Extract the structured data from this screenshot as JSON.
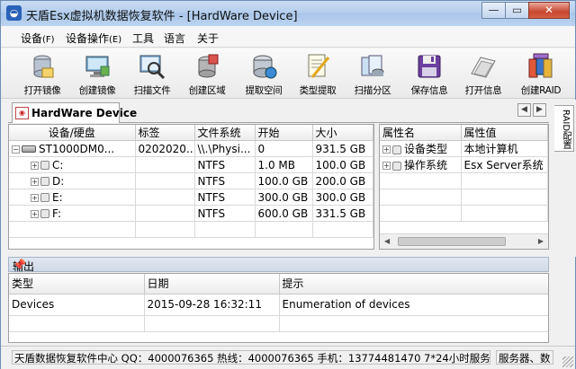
{
  "window": {
    "title": "天盾Esx虚拟机数据恢复软件 - [HardWare Device]"
  },
  "menu": [
    {
      "label": "设备",
      "acc": "(F)"
    },
    {
      "label": "设备操作",
      "acc": "(E)"
    },
    {
      "label": "工具",
      "acc": ""
    },
    {
      "label": "语言",
      "acc": ""
    },
    {
      "label": "关于",
      "acc": ""
    }
  ],
  "toolbar": [
    {
      "label": "打开镜像",
      "icon": "open-image-icon"
    },
    {
      "label": "创建镜像",
      "icon": "create-image-icon"
    },
    {
      "label": "扫描文件",
      "icon": "scan-files-icon"
    },
    {
      "label": "创建区域",
      "icon": "create-region-icon"
    },
    {
      "label": "提取空间",
      "icon": "extract-space-icon"
    },
    {
      "label": "类型提取",
      "icon": "type-extract-icon"
    },
    {
      "label": "扫描分区",
      "icon": "scan-partition-icon"
    },
    {
      "label": "保存信息",
      "icon": "save-info-icon"
    },
    {
      "label": "打开信息",
      "icon": "open-info-icon"
    },
    {
      "label": "创建RAID",
      "icon": "create-raid-icon"
    }
  ],
  "doc_tab": {
    "label": "HardWare Device"
  },
  "side_tab": {
    "label": "RAID配置"
  },
  "device_table": {
    "headers": [
      "设备/硬盘",
      "标签",
      "文件系统",
      "开始",
      "大小"
    ],
    "rows": [
      {
        "name": "ST1000DM0...",
        "label": "0202020...",
        "fs": "\\\\.\\Physi...",
        "start": "0",
        "size": "931.5 GB",
        "level": 0
      },
      {
        "name": "C:",
        "label": "",
        "fs": "NTFS",
        "start": "1.0 MB",
        "size": "100.0 GB",
        "level": 1
      },
      {
        "name": "D:",
        "label": "",
        "fs": "NTFS",
        "start": "100.0 GB",
        "size": "200.0 GB",
        "level": 1
      },
      {
        "name": "E:",
        "label": "",
        "fs": "NTFS",
        "start": "300.0 GB",
        "size": "300.0 GB",
        "level": 1
      },
      {
        "name": "F:",
        "label": "",
        "fs": "NTFS",
        "start": "600.0 GB",
        "size": "331.5 GB",
        "level": 1
      }
    ]
  },
  "property_table": {
    "headers": [
      "属性名",
      "属性值"
    ],
    "rows": [
      {
        "name": "设备类型",
        "value": "本地计算机"
      },
      {
        "name": "操作系统",
        "value": "Esx Server系统"
      }
    ]
  },
  "output": {
    "title": "输出",
    "headers": [
      "类型",
      "日期",
      "提示"
    ],
    "rows": [
      {
        "type": "Devices",
        "date": "2015-09-28 16:32:11",
        "hint": "Enumeration of devices"
      }
    ]
  },
  "status": {
    "left": "天盾数据恢复软件中心 QQ：4000076365 热线：4000076365 手机：13774481470  7*24小时服务",
    "right": "服务器、数"
  }
}
